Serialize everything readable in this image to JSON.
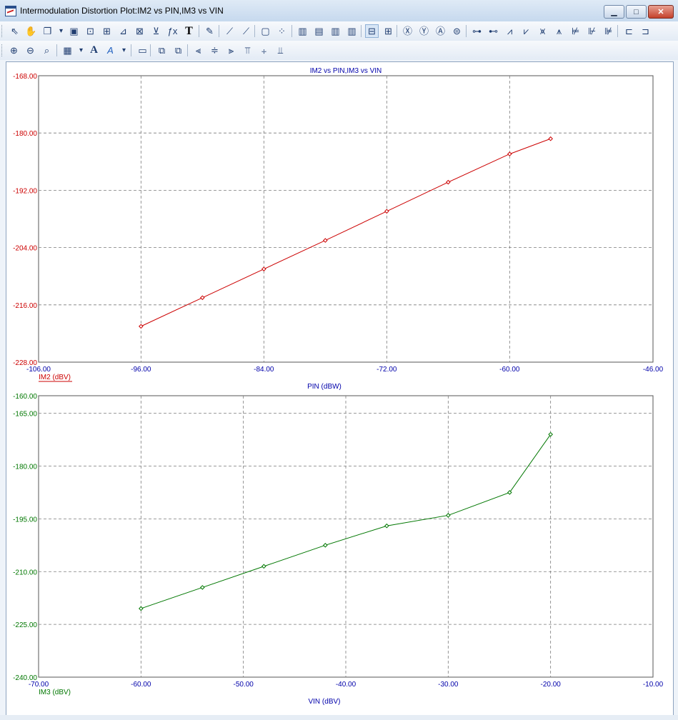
{
  "window": {
    "title": "Intermodulation Distortion Plot:IM2 vs PIN,IM3 vs VIN",
    "min_glyph": "▁",
    "max_glyph": "□",
    "close_glyph": "✕"
  },
  "toolbar1": [
    {
      "name": "select-arrow-icon",
      "glyph": "⇖"
    },
    {
      "name": "pan-hand-icon",
      "glyph": "✋"
    },
    {
      "name": "copy-plot-icon",
      "glyph": "❐"
    },
    {
      "name": "dropdown-arrow-icon",
      "glyph": "▾"
    },
    {
      "name": "image-icon",
      "glyph": "▣"
    },
    {
      "name": "zoom-fit-icon",
      "glyph": "⊡"
    },
    {
      "name": "axis-icon",
      "glyph": "⊞"
    },
    {
      "name": "trace-icon",
      "glyph": "⊿"
    },
    {
      "name": "marker-icon",
      "glyph": "⊠"
    },
    {
      "name": "measure-icon",
      "glyph": "⊻"
    },
    {
      "name": "function-icon",
      "glyph": "ƒx"
    },
    {
      "name": "text-tool-icon",
      "glyph": "T"
    },
    {
      "name": "properties-icon",
      "glyph": "✎"
    },
    {
      "name": "line-plot-icon",
      "glyph": "⟋"
    },
    {
      "name": "point-plot-icon",
      "glyph": "⟋"
    },
    {
      "name": "frame-icon",
      "glyph": "▢"
    },
    {
      "name": "grid-dots-icon",
      "glyph": "⁘"
    },
    {
      "name": "cursor-col1-icon",
      "glyph": "▥"
    },
    {
      "name": "cursor-col2-icon",
      "glyph": "▤"
    },
    {
      "name": "cursor-col3-icon",
      "glyph": "▥"
    },
    {
      "name": "cursor-col4-icon",
      "glyph": "▥"
    },
    {
      "name": "hline-icon",
      "glyph": "⊟"
    },
    {
      "name": "crosshair-icon",
      "glyph": "⊞"
    },
    {
      "name": "zoom-x-icon",
      "glyph": "Ⓧ"
    },
    {
      "name": "zoom-y-icon",
      "glyph": "Ⓨ"
    },
    {
      "name": "zoom-all-icon",
      "glyph": "Ⓐ"
    },
    {
      "name": "zoom-reset-icon",
      "glyph": "⊜"
    },
    {
      "name": "marker-peak-icon",
      "glyph": "⊶"
    },
    {
      "name": "marker-valley-icon",
      "glyph": "⊷"
    },
    {
      "name": "rise-icon",
      "glyph": "⩘"
    },
    {
      "name": "fall-icon",
      "glyph": "⩗"
    },
    {
      "name": "slope-pos-icon",
      "glyph": "⩙"
    },
    {
      "name": "slope-neg-icon",
      "glyph": "⩚"
    },
    {
      "name": "intersect-icon",
      "glyph": "⊭"
    },
    {
      "name": "cross-icon",
      "glyph": "⊮"
    },
    {
      "name": "diff-icon",
      "glyph": "⊯"
    },
    {
      "name": "fit-width-icon",
      "glyph": "⊏"
    },
    {
      "name": "fit-height-icon",
      "glyph": "⊐"
    }
  ],
  "toolbar2": [
    {
      "name": "zoom-in-icon",
      "glyph": "⊕"
    },
    {
      "name": "zoom-out-icon",
      "glyph": "⊖"
    },
    {
      "name": "zoom-100-icon",
      "glyph": "⌕"
    },
    {
      "name": "layout-grid-icon",
      "glyph": "▦"
    },
    {
      "name": "dropdown-arrow-icon",
      "glyph": "▾"
    },
    {
      "name": "font-icon",
      "glyph": "A"
    },
    {
      "name": "text-color-icon",
      "glyph": "A"
    },
    {
      "name": "dropdown-arrow-icon",
      "glyph": "▾"
    },
    {
      "name": "label-icon",
      "glyph": "▭"
    },
    {
      "name": "bring-front-icon",
      "glyph": "⧉"
    },
    {
      "name": "send-back-icon",
      "glyph": "⧉"
    },
    {
      "name": "align-left-icon",
      "glyph": "⫷"
    },
    {
      "name": "align-center-icon",
      "glyph": "≑"
    },
    {
      "name": "align-right-icon",
      "glyph": "⫸"
    },
    {
      "name": "align-top-icon",
      "glyph": "⫪"
    },
    {
      "name": "align-middle-icon",
      "glyph": "⧾"
    },
    {
      "name": "align-bottom-icon",
      "glyph": "⫫"
    }
  ],
  "colors": {
    "im2": "#cc0000",
    "im3": "#007700",
    "axis_text": "#0000aa",
    "grid": "#7a7a7a"
  },
  "chart_data": [
    {
      "type": "line",
      "title": "IM2 vs PIN,IM3 vs VIN",
      "xlabel": "PIN (dBW)",
      "ylabel": "IM2 (dBV)",
      "xlim": [
        -106,
        -46
      ],
      "ylim": [
        -228,
        -168
      ],
      "xticks": [
        -106,
        -96,
        -84,
        -72,
        -60,
        -46
      ],
      "yticks": [
        -168,
        -180,
        -192,
        -204,
        -216,
        -228
      ],
      "x_tick_labels": [
        "-106.00",
        "-96.00",
        "-84.00",
        "-72.00",
        "-60.00",
        "-46.00"
      ],
      "y_tick_labels": [
        "-168.00",
        "-180.00",
        "-192.00",
        "-204.00",
        "-216.00",
        "-228.00"
      ],
      "grid": true,
      "series": [
        {
          "name": "IM2 (dBV)",
          "x": [
            -96,
            -90,
            -84,
            -78,
            -72,
            -66,
            -60,
            -56
          ],
          "y": [
            -220.5,
            -214.5,
            -208.5,
            -202.5,
            -196.4,
            -190.3,
            -184.4,
            -181.2
          ]
        }
      ]
    },
    {
      "type": "line",
      "title": "",
      "xlabel": "VIN (dBV)",
      "ylabel": "IM3 (dBV)",
      "xlim": [
        -70,
        -10
      ],
      "ylim": [
        -240,
        -160
      ],
      "xticks": [
        -70,
        -60,
        -50,
        -40,
        -30,
        -20,
        -10
      ],
      "yticks": [
        -160,
        -165,
        -180,
        -195,
        -210,
        -225,
        -240
      ],
      "x_tick_labels": [
        "-70.00",
        "-60.00",
        "-50.00",
        "-40.00",
        "-30.00",
        "-20.00",
        "-10.00"
      ],
      "y_tick_labels": [
        "-160.00",
        "-165.00",
        "-180.00",
        "-195.00",
        "-210.00",
        "-225.00",
        "-240.00"
      ],
      "grid": true,
      "series": [
        {
          "name": "IM3 (dBV)",
          "x": [
            -60,
            -54,
            -48,
            -42,
            -36,
            -30,
            -24,
            -20
          ],
          "y": [
            -220.5,
            -214.5,
            -208.5,
            -202.5,
            -197.0,
            -194.0,
            -187.5,
            -171.0
          ]
        }
      ]
    }
  ]
}
